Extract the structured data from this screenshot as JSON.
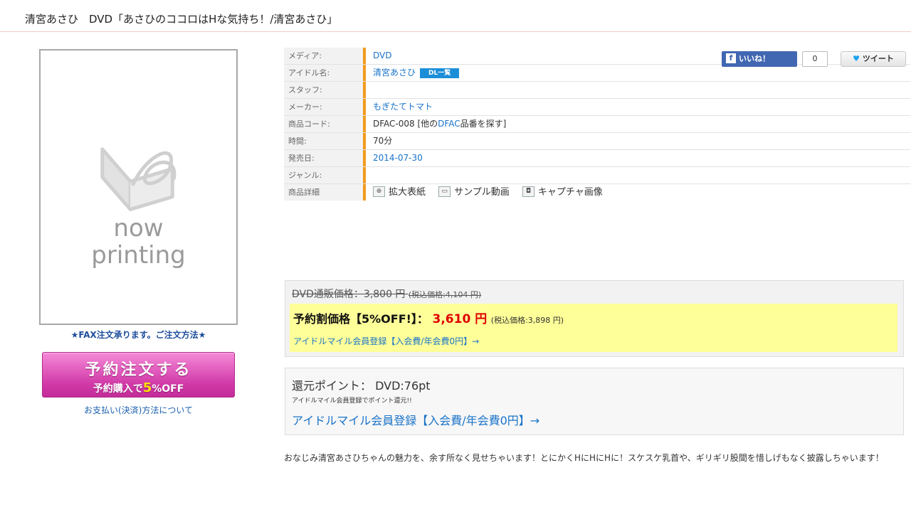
{
  "header": {
    "title": "清宮あさひ　DVD「あさひのココロはHな気持ち！/清宮あさひ」"
  },
  "cover": {
    "line1": "now",
    "line2": "printing"
  },
  "left": {
    "fax_text": "★FAX注文承ります。ご注文方法★",
    "order_button_main": "予約注文する",
    "order_button_sub_prefix": "予約購入で",
    "order_button_sub_pct": "5",
    "order_button_sub_suffix": "%OFF",
    "payment_link": "お支払い(決済)方法について"
  },
  "info": {
    "media_label": "メディア:",
    "media_value": "DVD",
    "idol_label": "アイドル名:",
    "idol_value": "清宮あさひ",
    "idol_badge": "DL一覧",
    "staff_label": "スタッフ:",
    "maker_label": "メーカー:",
    "maker_value": "もぎたてトマト",
    "code_label": "商品コード:",
    "code_value_prefix": "DFAC-008 [他の",
    "code_value_link": "DFAC",
    "code_value_suffix": "品番を探す]",
    "time_label": "時間:",
    "time_value": "70分",
    "release_label": "発売日:",
    "release_value": "2014-07-30",
    "genre_label": "ジャンル:",
    "detail_label": "商品詳細",
    "detail_items": [
      "拡大表紙",
      "サンプル動画",
      "キャプチャ画像"
    ]
  },
  "social": {
    "like_label": "いいね！",
    "like_count": "0",
    "tweet_label": "ツイート"
  },
  "price": {
    "regular_label": "DVD通販価格：",
    "regular_price": "3,800 円",
    "regular_tax": "(税込価格:4,104 円)",
    "sale_label": "予約割価格【5%OFF!】：",
    "sale_price": "3,610 円",
    "sale_tax": "(税込価格:3,898 円)",
    "member_link": "アイドルマイル会員登録【入会費/年会費0円】→"
  },
  "points": {
    "line": "還元ポイント： DVD:76pt",
    "note": "アイドルマイル会員登録でポイント還元!!",
    "link": "アイドルマイル会員登録【入会費/年会費0円】→"
  },
  "description": "おなじみ清宮あさひちゃんの魅力を、余す所なく見せちゃいます！とにかくHにHにHに！スケスケ乳首や、ギリギリ股間を惜しげもなく披露しちゃいます！",
  "colors": {
    "accent_bar": "#f39a1e",
    "link": "#1a73c8",
    "sale_price": "#e00000",
    "highlight": "#ffff99",
    "order_button": "#d13aa8"
  }
}
